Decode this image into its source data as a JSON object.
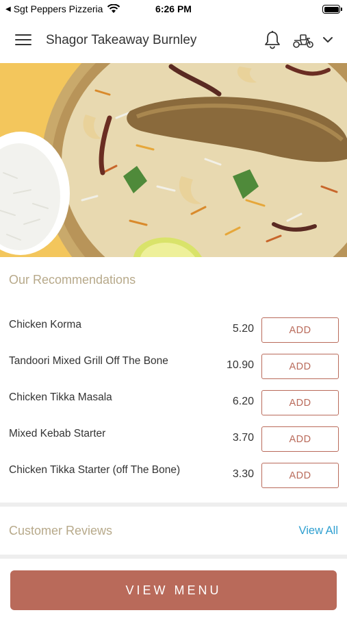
{
  "status_bar": {
    "carrier": "Sgt Peppers Pizzeria",
    "time": "6:26 PM",
    "icons": [
      "back-arrow-icon",
      "wifi-icon",
      "battery-icon"
    ]
  },
  "header": {
    "title": "Shagor Takeaway Burnley",
    "icons": [
      "hamburger-menu-icon",
      "bell-icon",
      "scooter-icon",
      "chevron-down-icon"
    ]
  },
  "hero": {
    "image": "biryani-dish-photo",
    "colors": {
      "background": "#f3c65c",
      "plate": "#c9a96b",
      "rice": "#e8d9b0"
    }
  },
  "recommendations": {
    "title": "Our Recommendations",
    "add_label": "ADD",
    "items": [
      {
        "name": "Chicken Korma",
        "price": "5.20"
      },
      {
        "name": "Tandoori Mixed Grill Off The Bone",
        "price": "10.90"
      },
      {
        "name": "Chicken Tikka Masala",
        "price": "6.20"
      },
      {
        "name": "Mixed Kebab Starter",
        "price": "3.70"
      },
      {
        "name": "Chicken Tikka Starter (off The Bone)",
        "price": "3.30"
      }
    ]
  },
  "reviews": {
    "title": "Customer Reviews",
    "view_all": "View All"
  },
  "footer": {
    "view_menu": "VIEW MENU"
  },
  "colors": {
    "accent": "#b96a5a",
    "section_title": "#b7a98a",
    "link": "#2e9fd0",
    "divider": "#eeeeee"
  }
}
